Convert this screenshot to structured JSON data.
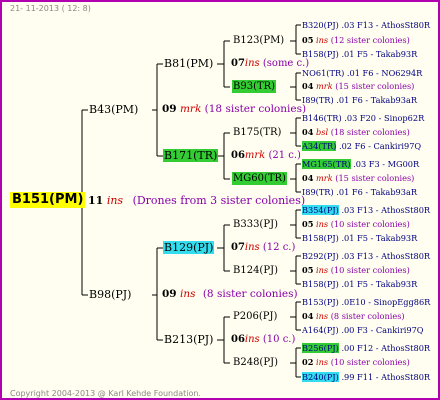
{
  "header": {
    "date": "21- 11-2013 ( 12: 8)"
  },
  "footer": {
    "copyright": "Copyright 2004-2013 @ Karl Kehde Foundation."
  },
  "colors": {
    "frame": "#b000b0",
    "background": "#fffef0",
    "root_highlight": "#ffff00",
    "green_highlight": "#33cc33",
    "cyan_highlight": "#33ddee",
    "mark": "#cc0000",
    "sister": "#8800aa",
    "text": "#000080"
  },
  "root": {
    "label": "B151(PM)"
  },
  "root_mating": {
    "num": "11",
    "mark": "ins",
    "sisters": "(Drones from 3 sister colonies)"
  },
  "gen1": [
    {
      "label": "B43(PM)"
    },
    {
      "label": "B98(PJ)"
    }
  ],
  "gen1_matings": [
    {
      "num": "09",
      "mark": "mrk",
      "sisters": "(18 sister colonies)"
    },
    {
      "num": "09",
      "mark": "ins",
      "sisters": "(8 sister colonies)"
    }
  ],
  "gen2": [
    {
      "label": "B81(PM)"
    },
    {
      "label": "B171(TR)"
    },
    {
      "label": "B129(PJ)"
    },
    {
      "label": "B213(PJ)"
    }
  ],
  "gen2_matings": [
    {
      "num": "07",
      "mark": "ins",
      "sisters": "(some c.)"
    },
    {
      "num": "06",
      "mark": "mrk",
      "sisters": "(21 c.)"
    },
    {
      "num": "07",
      "mark": "ins",
      "sisters": "(12 c.)"
    },
    {
      "num": "06",
      "mark": "ins",
      "sisters": "(10 c.)"
    }
  ],
  "gen3": [
    {
      "label": "B123(PM)"
    },
    {
      "label": "B93(TR)"
    },
    {
      "label": "B175(TR)"
    },
    {
      "label": "MG60(TR)"
    },
    {
      "label": "B333(PJ)"
    },
    {
      "label": "B124(PJ)"
    },
    {
      "label": "P206(PJ)"
    },
    {
      "label": "B248(PJ)"
    }
  ],
  "gen4": [
    {
      "label": "B320(PJ)",
      "info": ".03 F13 - AthosSt80R"
    },
    {
      "label": "B158(PJ)",
      "info": ".01     F5 - Takab93R"
    },
    {
      "label": "NO61(TR)",
      "info": ".01   F6 - NO6294R"
    },
    {
      "label": "I89(TR)",
      "info": ".01     F6 - Takab93aR"
    },
    {
      "label": "B146(TR)",
      "info": ".03   F20 - Sinop62R"
    },
    {
      "label": "A34(TR)",
      "info": ".02   F6 - Cankiri97Q"
    },
    {
      "label": "MG165(TR)",
      "info": ".03       F3 - MG00R"
    },
    {
      "label": "I89(TR)",
      "info": ".01     F6 - Takab93aR"
    },
    {
      "label": "B354(PJ)",
      "info": ".03 F13 - AthosSt80R"
    },
    {
      "label": "B158(PJ)",
      "info": ".01     F5 - Takab93R"
    },
    {
      "label": "B292(PJ)",
      "info": ".03 F13 - AthosSt80R"
    },
    {
      "label": "B158(PJ)",
      "info": ".01     F5 - Takab93R"
    },
    {
      "label": "B153(PJ)",
      "info": ".0E10 - SinopEgg86R"
    },
    {
      "label": "A164(PJ)",
      "info": ".00   F3 - Cankiri97Q"
    },
    {
      "label": "B256(PJ)",
      "info": ".00 F12 - AthosSt80R"
    },
    {
      "label": "B240(PJ)",
      "info": ".99 F11 - AthosSt80R"
    }
  ],
  "gen3_matings": [
    {
      "num": "05",
      "mark": "ins",
      "sisters": "(12 sister colonies)"
    },
    {
      "num": "04",
      "mark": "mrk",
      "sisters": "(15 sister colonies)"
    },
    {
      "num": "04",
      "mark": "bsl",
      "sisters": "(18 sister colonies)"
    },
    {
      "num": "04",
      "mark": "mrk",
      "sisters": "(15 sister colonies)"
    },
    {
      "num": "05",
      "mark": "ins",
      "sisters": "(10 sister colonies)"
    },
    {
      "num": "05",
      "mark": "ins",
      "sisters": "(10 sister colonies)"
    },
    {
      "num": "04",
      "mark": "ins",
      "sisters": "(8 sister colonies)"
    },
    {
      "num": "02",
      "mark": "ins",
      "sisters": "(10 sister colonies)"
    }
  ]
}
